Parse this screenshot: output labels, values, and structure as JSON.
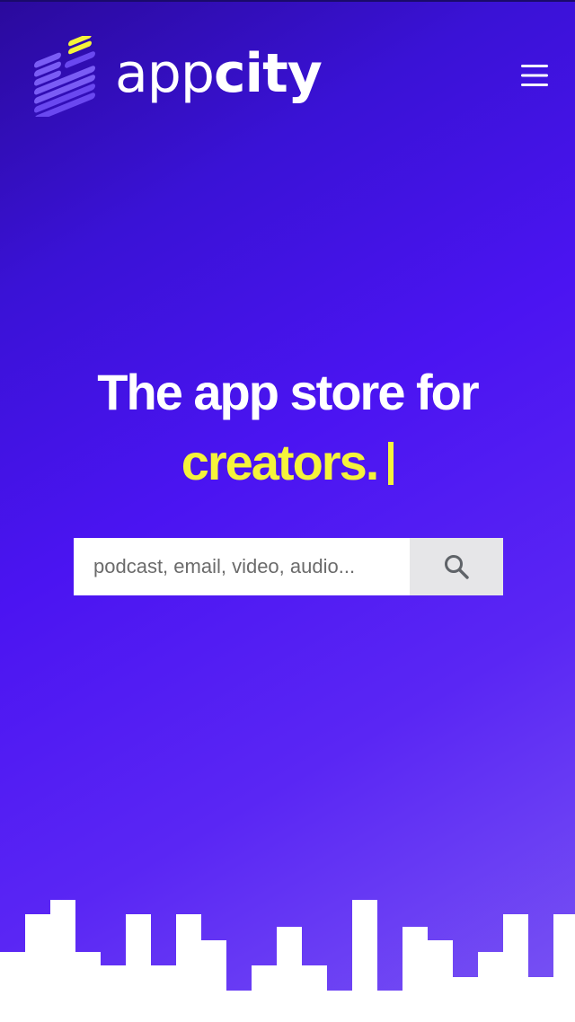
{
  "brand": {
    "name_light": "app",
    "name_bold": "city",
    "logo_icon": "appcity-logo-icon",
    "colors": {
      "logo_bars": "#7a5cf5",
      "logo_accent": "#f5f33b"
    }
  },
  "header": {
    "menu_icon": "hamburger-menu-icon"
  },
  "hero": {
    "headline_line1": "The app store for",
    "headline_accent": "creators.",
    "accent_color": "#f5f33b",
    "background_start": "#2a0a9c",
    "background_end": "#7a56f3"
  },
  "search": {
    "placeholder": "podcast, email, video, audio...",
    "value": "",
    "button_icon": "search-icon"
  },
  "footer_decoration": {
    "icon": "city-skyline-graphic",
    "color": "#ffffff"
  }
}
